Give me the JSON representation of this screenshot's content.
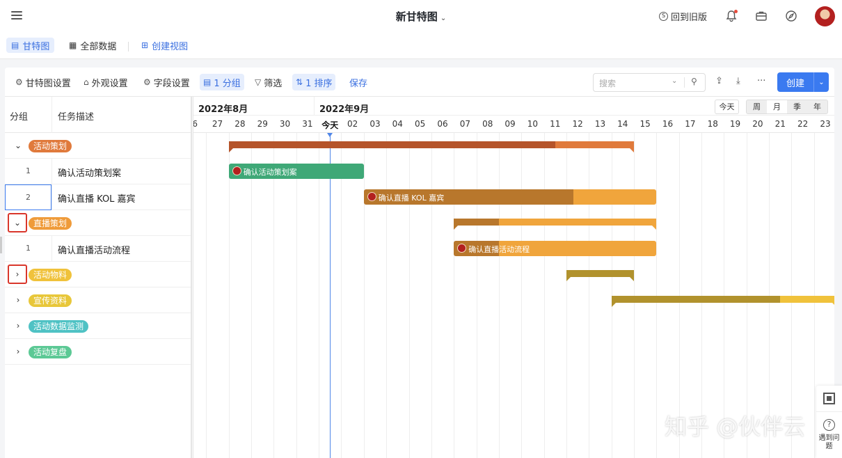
{
  "header": {
    "title": "新甘特图",
    "old_version": "回到旧版"
  },
  "views": {
    "tabs": [
      {
        "label": "甘特图",
        "active": true
      },
      {
        "label": "全部数据"
      }
    ],
    "create_view": "创建视图"
  },
  "toolbar": {
    "gantt_settings": "甘特图设置",
    "appearance": "外观设置",
    "fields": "字段设置",
    "group": "1 分组",
    "filter": "筛选",
    "sort": "1 排序",
    "save": "保存",
    "search_placeholder": "搜索",
    "create": "创建"
  },
  "table": {
    "col_group": "分组",
    "col_desc": "任务描述",
    "rows": [
      {
        "type": "group",
        "label": "活动策划",
        "color": "#e07a3c",
        "expanded": true
      },
      {
        "type": "task",
        "num": "1",
        "desc": "确认活动策划案"
      },
      {
        "type": "task",
        "num": "2",
        "desc": "确认直播 KOL 嘉宾",
        "selected": true
      },
      {
        "type": "group",
        "label": "直播策划",
        "color": "#ef9b3a",
        "expanded": true,
        "highlighted": true
      },
      {
        "type": "task",
        "num": "1",
        "desc": "确认直播活动流程"
      },
      {
        "type": "group",
        "label": "活动物料",
        "color": "#f0c23b",
        "expanded": false,
        "highlighted": true
      },
      {
        "type": "group",
        "label": "宣传资料",
        "color": "#e8c73a",
        "expanded": false
      },
      {
        "type": "group",
        "label": "活动数据监测",
        "color": "#4fc2c4",
        "expanded": false
      },
      {
        "type": "group",
        "label": "活动复盘",
        "color": "#5cc995",
        "expanded": false
      }
    ]
  },
  "timeline": {
    "months": [
      "2022年8月",
      "2022年9月"
    ],
    "days": [
      "6",
      "27",
      "28",
      "29",
      "30",
      "31",
      "今天",
      "02",
      "03",
      "04",
      "05",
      "06",
      "07",
      "08",
      "09",
      "10",
      "11",
      "12",
      "13",
      "14",
      "15",
      "16",
      "17",
      "18",
      "19",
      "20",
      "21",
      "22",
      "23"
    ],
    "today_button": "今天",
    "scales": [
      "周",
      "月",
      "季",
      "年"
    ],
    "active_scale": "月"
  },
  "bars": [
    {
      "kind": "group",
      "row": 0,
      "start": 1.5,
      "end": 19.5,
      "split": 16,
      "c1": "#b5542a",
      "c2": "#e07a3c"
    },
    {
      "kind": "task",
      "row": 1,
      "start": 1.5,
      "end": 7.5,
      "split": 7.5,
      "label": "确认活动策划案",
      "c1": "#3fa877",
      "c2": "#3fa877"
    },
    {
      "kind": "task",
      "row": 2,
      "start": 7.5,
      "end": 20.5,
      "split": 16.8,
      "label": "确认直播 KOL 嘉宾",
      "c1": "#b8772c",
      "c2": "#f0a53c"
    },
    {
      "kind": "group",
      "row": 3,
      "start": 11.5,
      "end": 20.5,
      "split": 13.5,
      "c1": "#b8772c",
      "c2": "#f0a53c"
    },
    {
      "kind": "task",
      "row": 4,
      "start": 11.5,
      "end": 20.5,
      "split": 13.5,
      "label": "确认直播活动流程",
      "c1": "#b8772c",
      "c2": "#f0a53c"
    },
    {
      "kind": "group",
      "row": 5,
      "start": 16.5,
      "end": 19.5,
      "split": 19.7,
      "c1": "#b1922d",
      "c2": "#f0c23b"
    },
    {
      "kind": "group",
      "row": 6,
      "start": 18.5,
      "end": 28.5,
      "split": 26,
      "c1": "#b1922d",
      "c2": "#f0c23b"
    }
  ],
  "side": {
    "help": "遇到问题"
  },
  "watermark": "知乎 @伙伴云"
}
